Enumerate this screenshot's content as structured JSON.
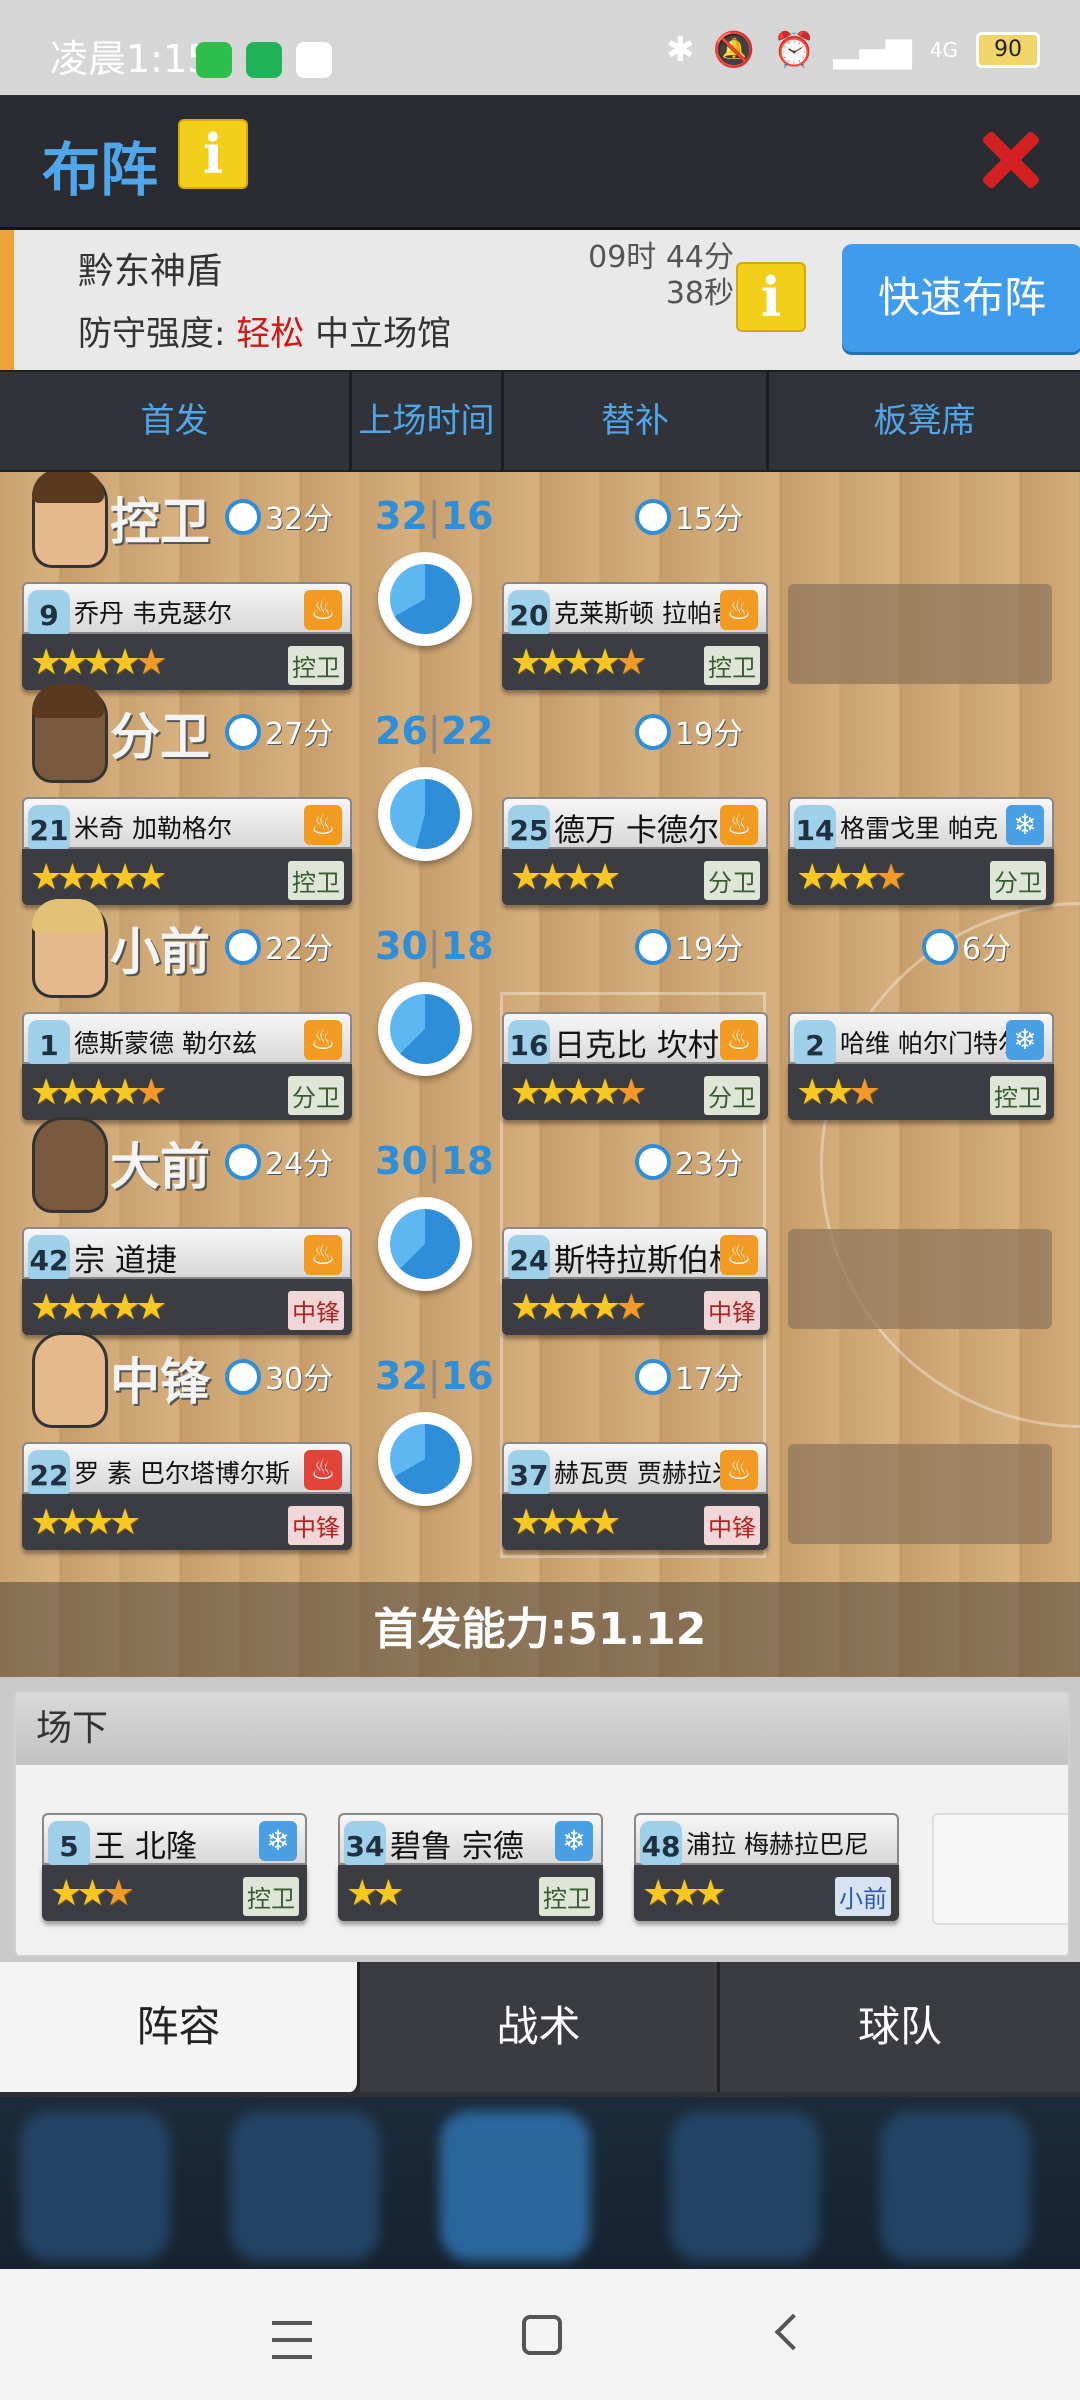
{
  "status_bar": {
    "time": "凌晨1:15",
    "battery": "90",
    "network": "4G"
  },
  "header": {
    "title": "布阵"
  },
  "opponent": {
    "name": "黔东神盾",
    "defense_label": "防守强度:",
    "defense_level": "轻松",
    "venue": "中立场馆",
    "timer_line1": "09时 44分",
    "timer_line2": "38秒",
    "quick_button": "快速布阵"
  },
  "tabs": [
    "首发",
    "上场时间",
    "替补",
    "板凳席"
  ],
  "lineup": [
    {
      "position": "控卫",
      "starter_minutes": "32分",
      "ratio_a": "32",
      "ratio_b": "16",
      "starter": {
        "number": "9",
        "name": "乔丹 韦克瑟尔",
        "stars": 4.5,
        "tag": "控卫",
        "badge": "fire"
      },
      "sub": {
        "number": "20",
        "name": "克莱斯顿 拉帕奇",
        "minutes": "15分",
        "stars": 4.5,
        "tag": "控卫",
        "badge": "fire"
      },
      "third": null
    },
    {
      "position": "分卫",
      "starter_minutes": "27分",
      "ratio_a": "26",
      "ratio_b": "22",
      "starter": {
        "number": "21",
        "name": "米奇 加勒格尔",
        "stars": 5,
        "tag": "控卫",
        "badge": "fire"
      },
      "sub": {
        "number": "25",
        "name": "德万 卡德尔",
        "minutes": "19分",
        "stars": 4,
        "tag": "分卫",
        "badge": "fire"
      },
      "third": {
        "number": "14",
        "name": "格雷戈里 帕克",
        "minutes": "",
        "stars": 3.5,
        "tag": "分卫",
        "badge": "ice"
      }
    },
    {
      "position": "小前",
      "starter_minutes": "22分",
      "ratio_a": "30",
      "ratio_b": "18",
      "starter": {
        "number": "1",
        "name": "德斯蒙德 勒尔兹",
        "stars": 4.5,
        "tag": "分卫",
        "badge": "fire"
      },
      "sub": {
        "number": "16",
        "name": "日克比 坎村",
        "minutes": "19分",
        "stars": 4.5,
        "tag": "分卫",
        "badge": "fire"
      },
      "third": {
        "number": "2",
        "name": "哈维 帕尔门特尔",
        "minutes": "6分",
        "stars": 2.5,
        "tag": "控卫",
        "badge": "ice"
      }
    },
    {
      "position": "大前",
      "starter_minutes": "24分",
      "ratio_a": "30",
      "ratio_b": "18",
      "starter": {
        "number": "42",
        "name": "宗 道捷",
        "stars": 5,
        "tag": "中锋",
        "badge": "fire"
      },
      "sub": {
        "number": "24",
        "name": "斯特拉斯伯格",
        "minutes": "23分",
        "stars": 4.5,
        "tag": "中锋",
        "badge": "fire"
      },
      "third": null
    },
    {
      "position": "中锋",
      "starter_minutes": "30分",
      "ratio_a": "32",
      "ratio_b": "16",
      "starter": {
        "number": "22",
        "name": "罗 素 巴尔塔博尔斯",
        "stars": 4,
        "tag": "中锋",
        "badge": "fire-red"
      },
      "sub": {
        "number": "37",
        "name": "赫瓦贾 贾赫拉米",
        "minutes": "17分",
        "stars": 4,
        "tag": "中锋",
        "badge": "fire"
      },
      "third": null
    }
  ],
  "starter_power": "首发能力:51.12",
  "bench": {
    "title": "场下",
    "players": [
      {
        "number": "5",
        "name": "王 北隆",
        "stars": 2.5,
        "tag": "控卫",
        "badge": "ice"
      },
      {
        "number": "34",
        "name": "碧鲁 宗德",
        "stars": 2,
        "tag": "控卫",
        "badge": "ice"
      },
      {
        "number": "48",
        "name": "浦拉 梅赫拉巴尼",
        "stars": 3,
        "tag": "小前",
        "badge": "none"
      }
    ]
  },
  "bottom_tabs": [
    "阵容",
    "战术",
    "球队"
  ],
  "colors": {
    "accent_blue": "#4fa6e8",
    "defense_red": "#d01818",
    "close_red": "#d42020",
    "info_yellow": "#f2cf1a"
  }
}
